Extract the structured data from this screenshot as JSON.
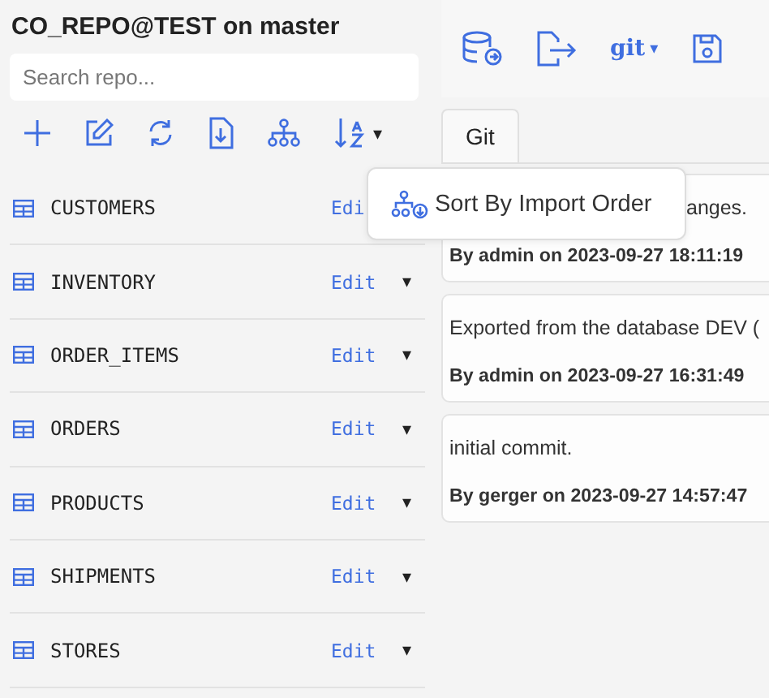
{
  "repo": {
    "title": "CO_REPO@TEST on master",
    "search": {
      "placeholder": "Search repo..."
    }
  },
  "toolbar": {
    "sort_caret": "▾"
  },
  "tables": [
    {
      "name": "CUSTOMERS",
      "edit": "Edi"
    },
    {
      "name": "INVENTORY",
      "edit": "Edit",
      "caret": "▾"
    },
    {
      "name": "ORDER_ITEMS",
      "edit": "Edit",
      "caret": "▾"
    },
    {
      "name": "ORDERS",
      "edit": "Edit",
      "caret": "▾"
    },
    {
      "name": "PRODUCTS",
      "edit": "Edit",
      "caret": "▾"
    },
    {
      "name": "SHIPMENTS",
      "edit": "Edit",
      "caret": "▾"
    },
    {
      "name": "STORES",
      "edit": "Edit",
      "caret": "▾"
    }
  ],
  "sort_menu": {
    "items": [
      {
        "label": "Sort By Import Order"
      }
    ]
  },
  "right_toolbar": {
    "git_label": "git",
    "git_caret": "▾"
  },
  "tabs": [
    {
      "label": "Git",
      "selected": true
    }
  ],
  "commits": [
    {
      "message": "anges.",
      "author_line": "By admin on 2023-09-27 18:11:19"
    },
    {
      "message": "Exported from the database DEV (",
      "author_line": "By admin on 2023-09-27 16:31:49"
    },
    {
      "message": "initial commit.",
      "author_line": "By gerger on 2023-09-27 14:57:47"
    }
  ]
}
